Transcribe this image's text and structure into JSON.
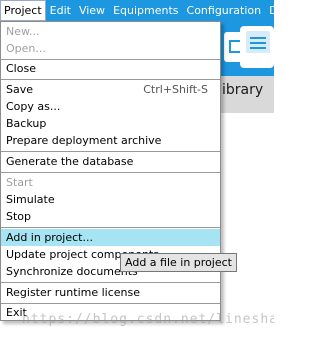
{
  "menubar": {
    "items": [
      "Project",
      "Edit",
      "View",
      "Equipments",
      "Configuration",
      "Deploy"
    ]
  },
  "background": {
    "library_label": "ibrary"
  },
  "project_menu": {
    "new": "New...",
    "open": "Open...",
    "close": "Close",
    "save": "Save",
    "save_shortcut": "Ctrl+Shift-S",
    "copy_as": "Copy as...",
    "backup": "Backup",
    "prepare_archive": "Prepare deployment archive",
    "generate_database": "Generate the database",
    "start": "Start",
    "simulate": "Simulate",
    "stop": "Stop",
    "add_in_project": "Add in project...",
    "update_components": "Update project components",
    "synchronize_documents": "Synchronize documents",
    "register_license": "Register runtime license",
    "exit": "Exit"
  },
  "tooltip": {
    "text": "Add a file in project"
  },
  "watermark": {
    "text": "https://blog.csdn.net/lineshao"
  },
  "colors": {
    "menubar": "#1c97e0",
    "highlight": "#a6e4f3",
    "disabled_text": "#a0a0a0"
  }
}
